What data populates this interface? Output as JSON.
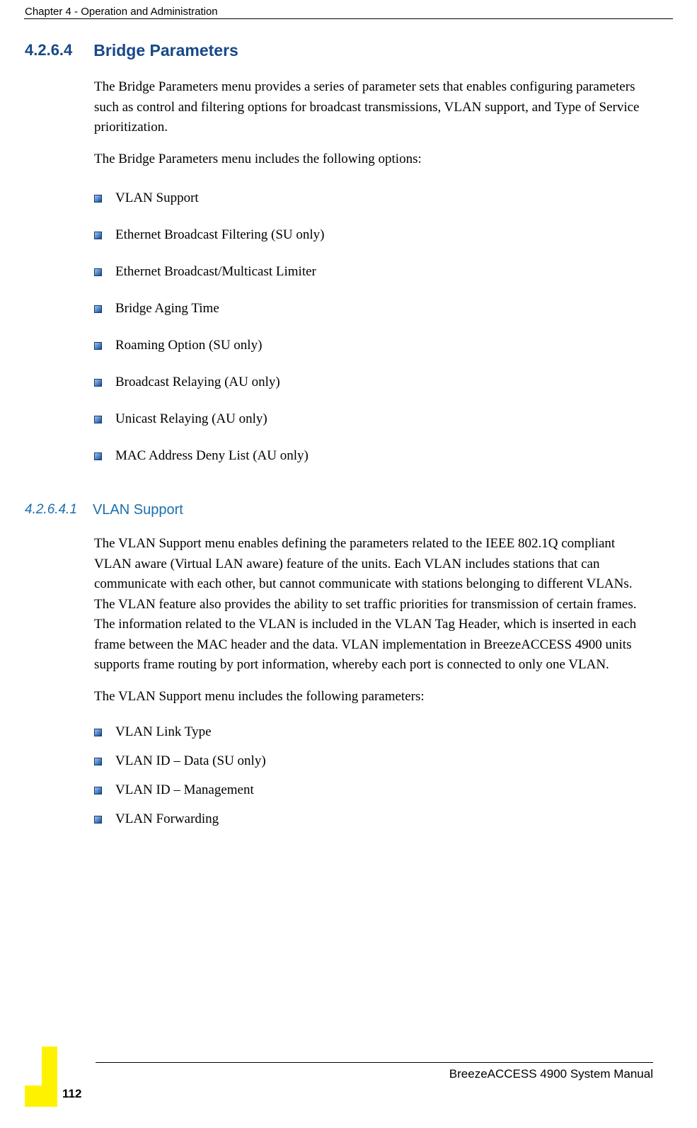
{
  "header": {
    "chapter": "Chapter 4 - Operation and Administration"
  },
  "section1": {
    "number": "4.2.6.4",
    "title": "Bridge Parameters",
    "intro": "The Bridge Parameters menu provides a series of parameter sets that enables configuring parameters such as control and filtering options for broadcast transmissions, VLAN support, and Type of Service prioritization.",
    "lead": "The Bridge Parameters menu includes the following options:",
    "items": [
      "VLAN Support",
      "Ethernet Broadcast Filtering (SU only)",
      "Ethernet Broadcast/Multicast Limiter",
      "Bridge Aging Time",
      "Roaming Option (SU only)",
      "Broadcast Relaying (AU only)",
      "Unicast Relaying (AU only)",
      "MAC Address Deny List (AU only)"
    ]
  },
  "section2": {
    "number": "4.2.6.4.1",
    "title": "VLAN Support",
    "intro": "The VLAN Support menu enables defining the parameters related to the IEEE 802.1Q compliant VLAN aware (Virtual LAN aware) feature of the units. Each VLAN includes stations that can communicate with each other, but cannot communicate with stations belonging to different VLANs. The VLAN feature also provides the ability to set traffic priorities for transmission of certain frames. The information related to the VLAN is included in the VLAN Tag Header, which is inserted in each frame between the MAC header and the data. VLAN implementation in BreezeACCESS 4900 units supports frame routing by port information, whereby each port is connected to only one VLAN.",
    "lead": "The VLAN Support menu includes the following parameters:",
    "items": [
      "VLAN Link Type",
      "VLAN ID – Data (SU only)",
      "VLAN ID – Management",
      "VLAN Forwarding"
    ]
  },
  "footer": {
    "manual": "BreezeACCESS 4900 System Manual",
    "page": "112"
  }
}
